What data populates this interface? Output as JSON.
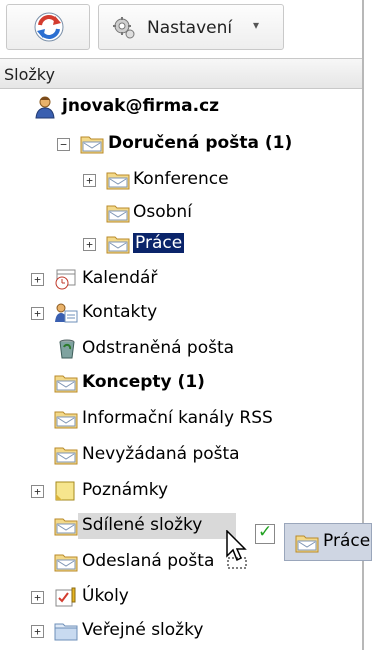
{
  "toolbar": {
    "refresh_icon": "refresh-icon",
    "settings_label": "Nastavení",
    "settings_icon": "gear-icon",
    "settings_caret": "▾"
  },
  "folders_header": "Složky",
  "tree": {
    "account": "jnovak@firma.cz",
    "inbox": "Doručená pošta (1)",
    "conference": "Konference",
    "personal": "Osobní",
    "work": "Práce",
    "calendar": "Kalendář",
    "contacts": "Kontakty",
    "deleted": "Odstraněná pošta",
    "drafts": "Koncepty (1)",
    "rss": "Informační kanály RSS",
    "junk": "Nevyžádaná pošta",
    "notes": "Poznámky",
    "shared": "Sdílené složky",
    "sent": "Odeslaná pošta",
    "tasks": "Úkoly",
    "public": "Veřejné složky"
  },
  "drag": {
    "ghost_label": "Práce",
    "drop_allowed_icon": "checkmark-icon"
  },
  "colors": {
    "selection": "#0a246a",
    "folder": "#e9c66a"
  }
}
